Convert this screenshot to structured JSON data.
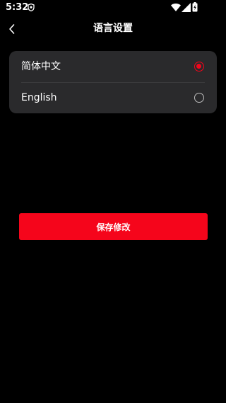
{
  "status_bar": {
    "time": "5:32",
    "icons": [
      "shield-icon",
      "wifi-icon",
      "cellular-signal-icon",
      "battery-charging-icon"
    ]
  },
  "app_bar": {
    "back_icon": "chevron-left-icon",
    "title": "语言设置"
  },
  "language_options": [
    {
      "label": "简体中文",
      "selected": true
    },
    {
      "label": "English",
      "selected": false
    }
  ],
  "save_button": {
    "label": "保存修改"
  },
  "colors": {
    "background": "#000000",
    "card": "#2a2a2c",
    "accent": "#f5051b",
    "text": "#ffffff",
    "radio_unchecked": "#bdbdbd"
  }
}
